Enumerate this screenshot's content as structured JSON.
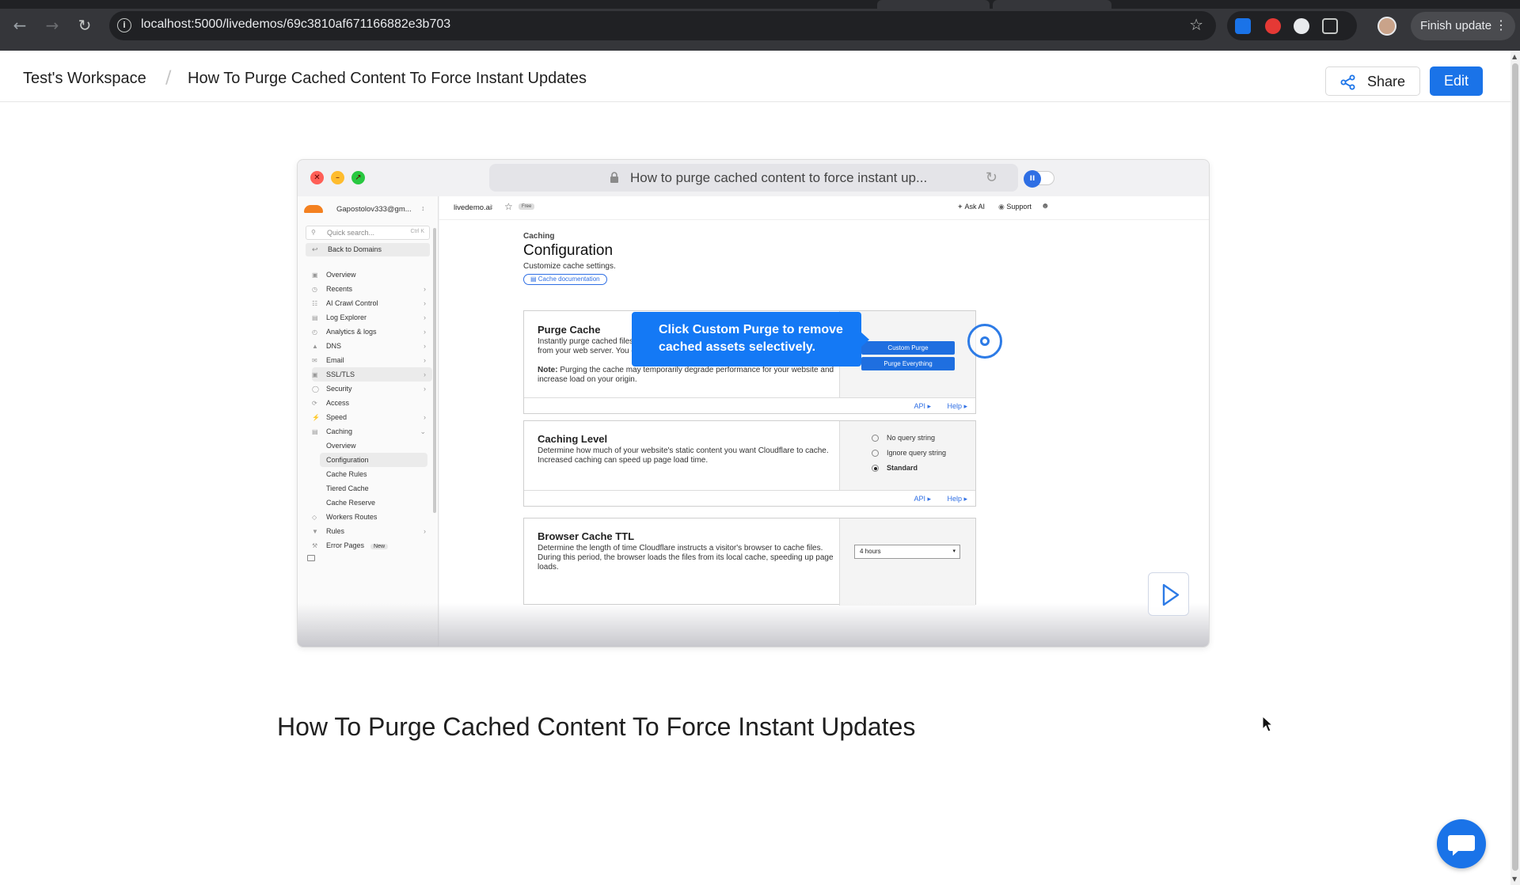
{
  "browser": {
    "url": "localhost:5000/livedemos/69c3810af671166882e3b703",
    "finish_update_label": "Finish update"
  },
  "header": {
    "workspace": "Test's Workspace",
    "separator": "/",
    "page_title": "How To Purge Cached Content To Force Instant Updates",
    "share_label": "Share",
    "edit_label": "Edit"
  },
  "demo": {
    "address_text": "How to purge cached content to force instant up...",
    "tooltip_text": "Click Custom Purge to remove cached assets selectively.",
    "sidebar": {
      "account": "Gapostolov333@gm...",
      "search_placeholder": "Quick search...",
      "search_shortcut": "Ctrl K",
      "back": "Back to Domains",
      "items": [
        {
          "label": "Overview",
          "chevron": false
        },
        {
          "label": "Recents",
          "chevron": true
        },
        {
          "label": "AI Crawl Control",
          "chevron": true
        },
        {
          "label": "Log Explorer",
          "chevron": true
        },
        {
          "label": "Analytics & logs",
          "chevron": true
        },
        {
          "label": "DNS",
          "chevron": true
        },
        {
          "label": "Email",
          "chevron": true
        },
        {
          "label": "SSL/TLS",
          "chevron": true
        },
        {
          "label": "Security",
          "chevron": true
        },
        {
          "label": "Access",
          "chevron": false
        },
        {
          "label": "Speed",
          "chevron": true
        },
        {
          "label": "Caching",
          "chevron": true
        }
      ],
      "caching_sub": [
        "Overview",
        "Configuration",
        "Cache Rules",
        "Tiered Cache",
        "Cache Reserve"
      ],
      "after_items": [
        {
          "label": "Workers Routes",
          "chevron": false
        },
        {
          "label": "Rules",
          "chevron": true
        },
        {
          "label": "Error Pages",
          "chevron": false,
          "badge": "New"
        }
      ]
    },
    "topnav": {
      "domain": "livedemo.ai",
      "plan": "Free",
      "ask_ai": "Ask AI",
      "support": "Support"
    },
    "page": {
      "section": "Caching",
      "title": "Configuration",
      "subtitle": "Customize cache settings.",
      "doc_link": "Cache documentation"
    },
    "purge_card": {
      "title": "Purge Cache",
      "desc1": "Instantly purge cached files t",
      "desc2": "from your web server. You ca",
      "note_label": "Note:",
      "note": " Purging the cache may temporarily degrade performance for your website and",
      "note2": "increase load on your origin.",
      "btn_custom": "Custom Purge",
      "btn_all": "Purge Everything",
      "api": "API",
      "help": "Help"
    },
    "level_card": {
      "title": "Caching Level",
      "desc1": "Determine how much of your website's static content you want Cloudflare to cache.",
      "desc2": "Increased caching can speed up page load time.",
      "options": [
        "No query string",
        "Ignore query string",
        "Standard"
      ],
      "selected": "Standard",
      "api": "API",
      "help": "Help"
    },
    "ttl_card": {
      "title": "Browser Cache TTL",
      "desc1": "Determine the length of time Cloudflare instructs a visitor's browser to cache files.",
      "desc2": "During this period, the browser loads the files from its local cache, speeding up page",
      "desc3": "loads.",
      "select_value": "4 hours"
    }
  },
  "main_heading": "How To Purge Cached Content To Force Instant Updates",
  "colors": {
    "accent": "#1a73e8",
    "tooltip": "#1479f5",
    "chrome": "#35363a"
  }
}
